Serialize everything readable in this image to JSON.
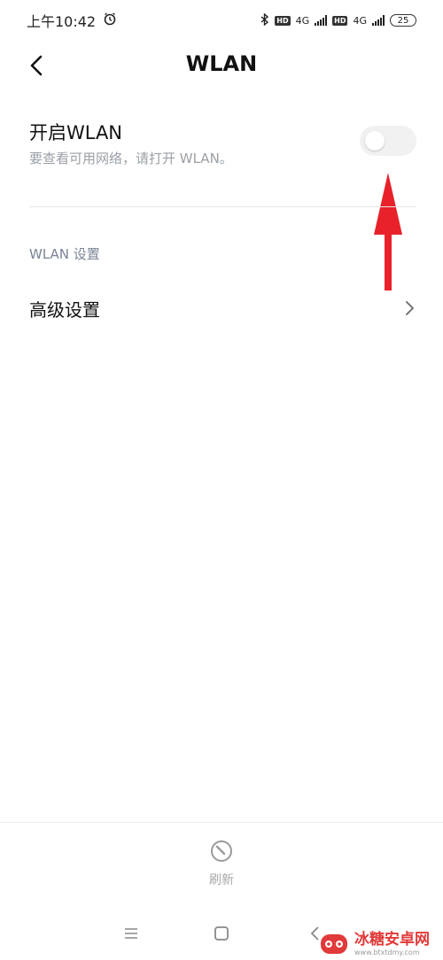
{
  "status_bar": {
    "time": "上午10:42",
    "hd_1": "HD",
    "net_1": "4G",
    "hd_2": "HD",
    "net_2": "4G",
    "battery": "25"
  },
  "header": {
    "title": "WLAN"
  },
  "wlan_toggle": {
    "label": "开启WLAN",
    "description": "要查看可用网络，请打开 WLAN。",
    "enabled": false
  },
  "settings_section": {
    "title": "WLAN 设置",
    "advanced_label": "高级设置"
  },
  "bottom_bar": {
    "refresh_label": "刷新"
  },
  "watermark": {
    "name": "冰糖安卓网",
    "url": "www.btxtdmy.com"
  },
  "colors": {
    "annotation_arrow": "#e8212b",
    "secondary_text": "#9aa0a6",
    "section_title": "#7a8494",
    "toggle_off": "#f1f1f1"
  },
  "icons": [
    "alarm-icon",
    "bluetooth-icon",
    "signal-icon",
    "battery-icon",
    "back-icon",
    "chevron-right-icon",
    "refresh-icon",
    "menu-icon",
    "home-icon",
    "back-nav-icon"
  ]
}
